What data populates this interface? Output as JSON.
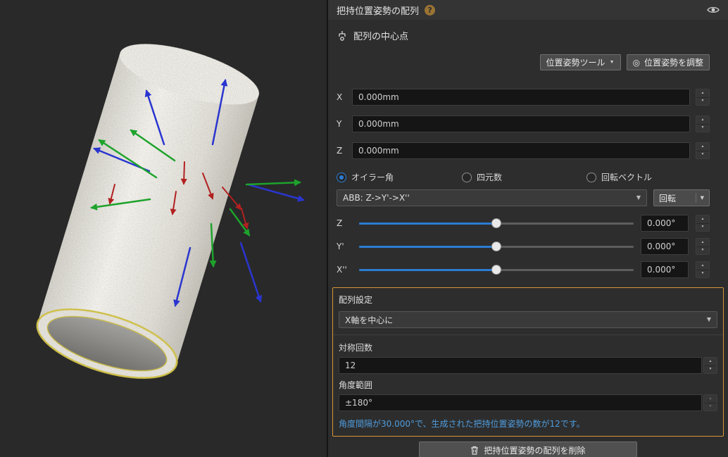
{
  "viewport": {
    "description": "3D view of a cylindrical tube point cloud with arrayed grasp pose coordinate axes",
    "axis_colors": {
      "x": "#b22020",
      "y": "#1da32c",
      "z": "#2a35cf"
    },
    "selection_highlight": "#d6c640"
  },
  "panel": {
    "title": "把持位置姿勢の配列",
    "section_title": "配列の中心点",
    "pose_tool_button": "位置姿勢ツール",
    "adjust_pose_button": "位置姿勢を調整",
    "coords": [
      {
        "label": "X",
        "value": "0.000mm"
      },
      {
        "label": "Y",
        "value": "0.000mm"
      },
      {
        "label": "Z",
        "value": "0.000mm"
      }
    ],
    "rotation_modes": [
      {
        "label": "オイラー角"
      },
      {
        "label": "四元数"
      },
      {
        "label": "回転ベクトル"
      }
    ],
    "euler_convention": "ABB: Z->Y'->X''",
    "rotate_button": "回転",
    "sliders": [
      {
        "label": "Z",
        "value": "0.000°"
      },
      {
        "label": "Y'",
        "value": "0.000°"
      },
      {
        "label": "X''",
        "value": "0.000°"
      }
    ],
    "array_settings": {
      "title": "配列設定",
      "axis_option": "X軸を中心に",
      "symmetry_label": "対称回数",
      "symmetry_value": "12",
      "range_label": "角度範囲",
      "range_value": "±180°",
      "info_text": "角度間隔が30.000°で、生成された把持位置姿勢の数が12です。"
    },
    "delete_button": "把持位置姿勢の配列を削除"
  },
  "icons": {
    "help": "?",
    "caret": "▼",
    "spin_up": "▲",
    "spin_down": "▼",
    "target": "◎"
  },
  "colors": {
    "accent_blue": "#2b7cd3",
    "highlight_orange": "#d9953a",
    "info_text_blue": "#4f9cdd"
  }
}
